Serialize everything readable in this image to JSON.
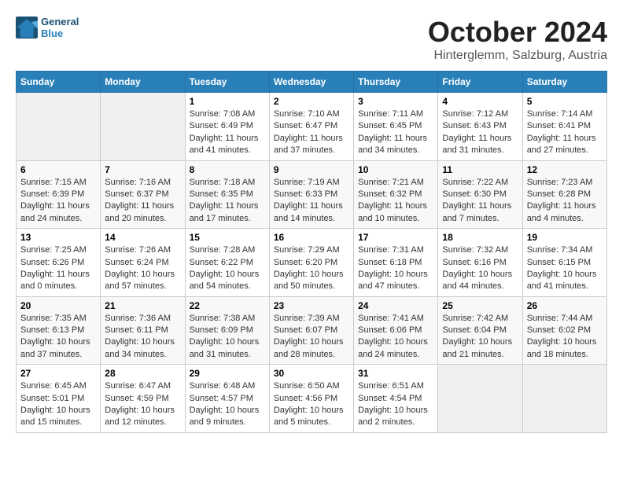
{
  "header": {
    "logo_line1": "General",
    "logo_line2": "Blue",
    "month_title": "October 2024",
    "location": "Hinterglemm, Salzburg, Austria"
  },
  "weekdays": [
    "Sunday",
    "Monday",
    "Tuesday",
    "Wednesday",
    "Thursday",
    "Friday",
    "Saturday"
  ],
  "weeks": [
    [
      {
        "day": "",
        "info": ""
      },
      {
        "day": "",
        "info": ""
      },
      {
        "day": "1",
        "info": "Sunrise: 7:08 AM\nSunset: 6:49 PM\nDaylight: 11 hours and 41 minutes."
      },
      {
        "day": "2",
        "info": "Sunrise: 7:10 AM\nSunset: 6:47 PM\nDaylight: 11 hours and 37 minutes."
      },
      {
        "day": "3",
        "info": "Sunrise: 7:11 AM\nSunset: 6:45 PM\nDaylight: 11 hours and 34 minutes."
      },
      {
        "day": "4",
        "info": "Sunrise: 7:12 AM\nSunset: 6:43 PM\nDaylight: 11 hours and 31 minutes."
      },
      {
        "day": "5",
        "info": "Sunrise: 7:14 AM\nSunset: 6:41 PM\nDaylight: 11 hours and 27 minutes."
      }
    ],
    [
      {
        "day": "6",
        "info": "Sunrise: 7:15 AM\nSunset: 6:39 PM\nDaylight: 11 hours and 24 minutes."
      },
      {
        "day": "7",
        "info": "Sunrise: 7:16 AM\nSunset: 6:37 PM\nDaylight: 11 hours and 20 minutes."
      },
      {
        "day": "8",
        "info": "Sunrise: 7:18 AM\nSunset: 6:35 PM\nDaylight: 11 hours and 17 minutes."
      },
      {
        "day": "9",
        "info": "Sunrise: 7:19 AM\nSunset: 6:33 PM\nDaylight: 11 hours and 14 minutes."
      },
      {
        "day": "10",
        "info": "Sunrise: 7:21 AM\nSunset: 6:32 PM\nDaylight: 11 hours and 10 minutes."
      },
      {
        "day": "11",
        "info": "Sunrise: 7:22 AM\nSunset: 6:30 PM\nDaylight: 11 hours and 7 minutes."
      },
      {
        "day": "12",
        "info": "Sunrise: 7:23 AM\nSunset: 6:28 PM\nDaylight: 11 hours and 4 minutes."
      }
    ],
    [
      {
        "day": "13",
        "info": "Sunrise: 7:25 AM\nSunset: 6:26 PM\nDaylight: 11 hours and 0 minutes."
      },
      {
        "day": "14",
        "info": "Sunrise: 7:26 AM\nSunset: 6:24 PM\nDaylight: 10 hours and 57 minutes."
      },
      {
        "day": "15",
        "info": "Sunrise: 7:28 AM\nSunset: 6:22 PM\nDaylight: 10 hours and 54 minutes."
      },
      {
        "day": "16",
        "info": "Sunrise: 7:29 AM\nSunset: 6:20 PM\nDaylight: 10 hours and 50 minutes."
      },
      {
        "day": "17",
        "info": "Sunrise: 7:31 AM\nSunset: 6:18 PM\nDaylight: 10 hours and 47 minutes."
      },
      {
        "day": "18",
        "info": "Sunrise: 7:32 AM\nSunset: 6:16 PM\nDaylight: 10 hours and 44 minutes."
      },
      {
        "day": "19",
        "info": "Sunrise: 7:34 AM\nSunset: 6:15 PM\nDaylight: 10 hours and 41 minutes."
      }
    ],
    [
      {
        "day": "20",
        "info": "Sunrise: 7:35 AM\nSunset: 6:13 PM\nDaylight: 10 hours and 37 minutes."
      },
      {
        "day": "21",
        "info": "Sunrise: 7:36 AM\nSunset: 6:11 PM\nDaylight: 10 hours and 34 minutes."
      },
      {
        "day": "22",
        "info": "Sunrise: 7:38 AM\nSunset: 6:09 PM\nDaylight: 10 hours and 31 minutes."
      },
      {
        "day": "23",
        "info": "Sunrise: 7:39 AM\nSunset: 6:07 PM\nDaylight: 10 hours and 28 minutes."
      },
      {
        "day": "24",
        "info": "Sunrise: 7:41 AM\nSunset: 6:06 PM\nDaylight: 10 hours and 24 minutes."
      },
      {
        "day": "25",
        "info": "Sunrise: 7:42 AM\nSunset: 6:04 PM\nDaylight: 10 hours and 21 minutes."
      },
      {
        "day": "26",
        "info": "Sunrise: 7:44 AM\nSunset: 6:02 PM\nDaylight: 10 hours and 18 minutes."
      }
    ],
    [
      {
        "day": "27",
        "info": "Sunrise: 6:45 AM\nSunset: 5:01 PM\nDaylight: 10 hours and 15 minutes."
      },
      {
        "day": "28",
        "info": "Sunrise: 6:47 AM\nSunset: 4:59 PM\nDaylight: 10 hours and 12 minutes."
      },
      {
        "day": "29",
        "info": "Sunrise: 6:48 AM\nSunset: 4:57 PM\nDaylight: 10 hours and 9 minutes."
      },
      {
        "day": "30",
        "info": "Sunrise: 6:50 AM\nSunset: 4:56 PM\nDaylight: 10 hours and 5 minutes."
      },
      {
        "day": "31",
        "info": "Sunrise: 6:51 AM\nSunset: 4:54 PM\nDaylight: 10 hours and 2 minutes."
      },
      {
        "day": "",
        "info": ""
      },
      {
        "day": "",
        "info": ""
      }
    ]
  ]
}
